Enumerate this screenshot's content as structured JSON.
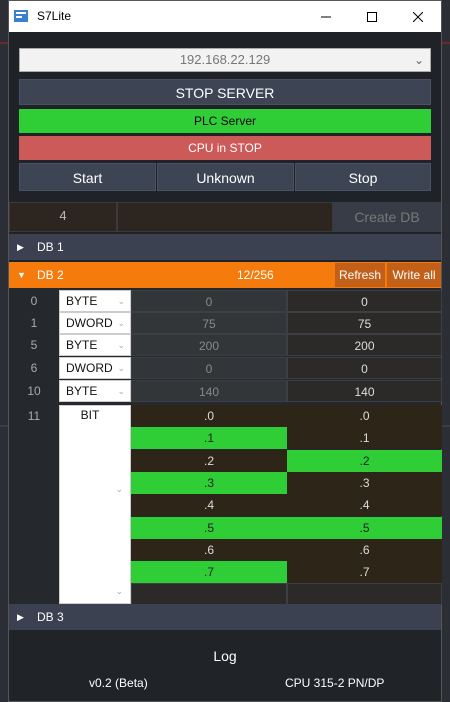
{
  "window": {
    "title": "S7Lite"
  },
  "server": {
    "ip": "192.168.22.129",
    "stop_label": "STOP SERVER",
    "plc_status": "PLC Server",
    "cpu_status": "CPU in STOP",
    "controls": {
      "start": "Start",
      "state": "Unknown",
      "stop": "Stop"
    }
  },
  "db_create": {
    "number": "4",
    "create_label": "Create DB"
  },
  "databases": {
    "db1": {
      "label": "DB 1"
    },
    "db2": {
      "label": "DB 2",
      "count": "12/256",
      "refresh": "Refresh",
      "write_all": "Write all"
    },
    "db3": {
      "label": "DB 3"
    }
  },
  "rows": [
    {
      "offset": "0",
      "type": "BYTE",
      "current": "0",
      "write": "0"
    },
    {
      "offset": "1",
      "type": "DWORD",
      "current": "75",
      "write": "75"
    },
    {
      "offset": "5",
      "type": "BYTE",
      "current": "200",
      "write": "200"
    },
    {
      "offset": "6",
      "type": "DWORD",
      "current": "0",
      "write": "0"
    },
    {
      "offset": "10",
      "type": "BYTE",
      "current": "140",
      "write": "140"
    }
  ],
  "bit_row": {
    "offset": "11",
    "type": "BIT"
  },
  "bits": [
    {
      "label": ".0",
      "current_on": false,
      "write_on": false
    },
    {
      "label": ".1",
      "current_on": true,
      "write_on": false
    },
    {
      "label": ".2",
      "current_on": false,
      "write_on": true
    },
    {
      "label": ".3",
      "current_on": true,
      "write_on": false
    },
    {
      "label": ".4",
      "current_on": false,
      "write_on": false
    },
    {
      "label": ".5",
      "current_on": true,
      "write_on": true
    },
    {
      "label": ".6",
      "current_on": false,
      "write_on": false
    },
    {
      "label": ".7",
      "current_on": true,
      "write_on": false
    }
  ],
  "log": {
    "title": "Log",
    "version": "v0.2 (Beta)",
    "cpu": "CPU 315-2 PN/DP"
  },
  "colors": {
    "green": "#2fcd36",
    "red": "#cc5a58",
    "orange": "#f57b0d",
    "button": "#3d4453"
  }
}
